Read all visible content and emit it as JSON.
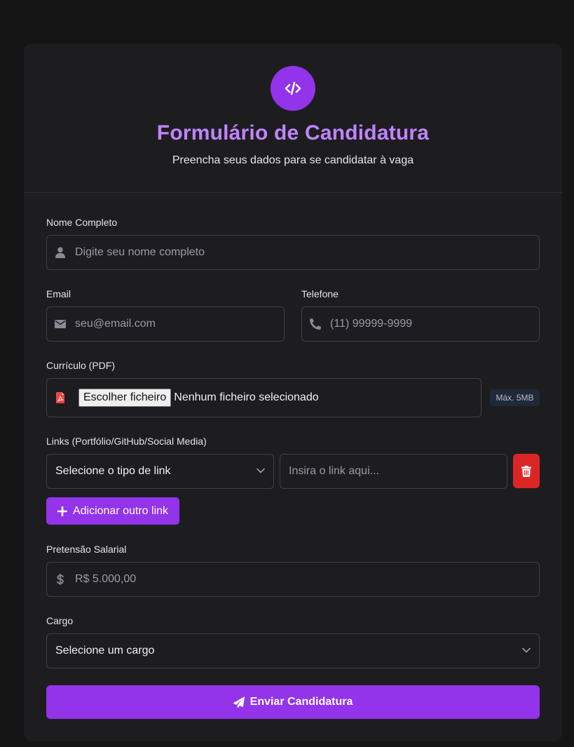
{
  "header": {
    "logo_icon": "code-icon",
    "title": "Formulário de Candidatura",
    "subtitle": "Preencha seus dados para se candidatar à vaga"
  },
  "form": {
    "name": {
      "label": "Nome Completo",
      "placeholder": "Digite seu nome completo",
      "icon": "user-icon"
    },
    "email": {
      "label": "Email",
      "placeholder": "seu@email.com",
      "icon": "envelope-icon"
    },
    "phone": {
      "label": "Telefone",
      "placeholder": "(11) 99999-9999",
      "icon": "phone-icon"
    },
    "resume": {
      "label": "Currículo (PDF)",
      "button": "Escolher ficheiro",
      "status": "Nenhum ficheiro selecionado",
      "max_size": "Máx. 5MB",
      "icon": "file-pdf-icon"
    },
    "links": {
      "label": "Links (Portfólio/GitHub/Social Media)",
      "type_select": "Selecione o tipo de link",
      "url_placeholder": "Insira o link aqui...",
      "add_button": "Adicionar outro link"
    },
    "salary": {
      "label": "Pretensão Salarial",
      "placeholder": "R$ 5.000,00",
      "icon": "dollar-icon"
    },
    "role": {
      "label": "Cargo",
      "select": "Selecione um cargo"
    },
    "submit": "Enviar Candidatura"
  },
  "colors": {
    "accent": "#9333ea",
    "title": "#c084fc",
    "danger": "#dc2626",
    "background": "#151516",
    "card": "#1d1d20"
  }
}
